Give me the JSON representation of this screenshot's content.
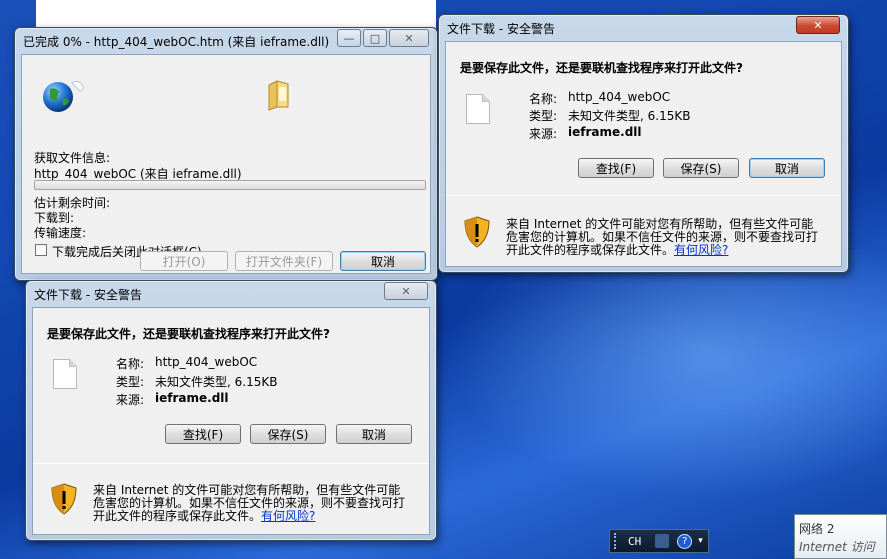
{
  "progress_dialog": {
    "title": "已完成 0% - http_404_webOC.htm (来自 ieframe.dll)",
    "progress_percent": 0,
    "getting_info_label": "获取文件信息:",
    "source_text": "http_404_webOC (来自 ieframe.dll)",
    "time_left_label": "估计剩余时间:",
    "download_to_label": "下载到:",
    "transfer_rate_label": "传输速度:",
    "close_on_complete_label": "下载完成后关闭此对话框(C)",
    "open_button": "打开(O)",
    "open_folder_button": "打开文件夹(F)",
    "cancel_button": "取消"
  },
  "security_dialog_top": {
    "title": "文件下载 - 安全警告",
    "question": "是要保存此文件，还是要联机查找程序来打开此文件?",
    "name_label": "名称:",
    "name_value": "http_404_webOC",
    "type_label": "类型:",
    "type_value": "未知文件类型, 6.15KB",
    "from_label": "来源:",
    "from_value": "ieframe.dll",
    "find_button": "查找(F)",
    "save_button": "保存(S)",
    "cancel_button": "取消",
    "warning_line1": "来自 Internet 的文件可能对您有所帮助，但有些文件可能",
    "warning_line2": "危害您的计算机。如果不信任文件的来源，则不要查找可打",
    "warning_line3": "开此文件的程序或保存此文件。",
    "risk_link": "有何风险?"
  },
  "security_dialog_bottom": {
    "title": "文件下载 - 安全警告",
    "question": "是要保存此文件，还是要联机查找程序来打开此文件?",
    "name_label": "名称:",
    "name_value": "http_404_webOC",
    "type_label": "类型:",
    "type_value": "未知文件类型, 6.15KB",
    "from_label": "来源:",
    "from_value": "ieframe.dll",
    "find_button": "查找(F)",
    "save_button": "保存(S)",
    "cancel_button": "取消",
    "warning_line1": "来自 Internet 的文件可能对您有所帮助，但有些文件可能",
    "warning_line2": "危害您的计算机。如果不信任文件的来源，则不要查找可打",
    "warning_line3": "开此文件的程序或保存此文件。",
    "risk_link": "有何风险?"
  },
  "tray": {
    "lang": "CH"
  },
  "network_popup": {
    "line1": "网络  2",
    "line2": "Internet 访问"
  }
}
